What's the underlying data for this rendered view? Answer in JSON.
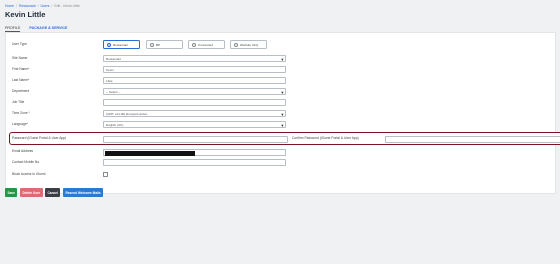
{
  "breadcrumb": {
    "home": "Home",
    "restaurant": "Restaurant",
    "users": "Users",
    "current": "Edit - Kevin Little"
  },
  "page": {
    "title": "Kevin Little"
  },
  "tabs": [
    {
      "label": "PROFILE"
    },
    {
      "label": "PACKAGE & SERVICE"
    }
  ],
  "form": {
    "user_type_label": "User Type",
    "user_types": [
      {
        "label": "Restaurant",
        "selected": true
      },
      {
        "label": "BP",
        "selected": false
      },
      {
        "label": "Connected",
        "selected": false
      },
      {
        "label": "Website Only",
        "selected": false
      }
    ],
    "site_name_label": "Site Name",
    "site_name_value": "Restaurant",
    "first_name_label": "First Name*",
    "first_name_value": "Kevin",
    "last_name_label": "Last Name*",
    "last_name_value": "Little",
    "department_label": "Department",
    "department_value": "-- Select --",
    "job_title_label": "Job Title",
    "job_title_value": "",
    "time_zone_label": "Time Zone *",
    "time_zone_value": "(GMT +01:00) Europe/London",
    "language_label": "Language*",
    "language_value": "English (UK)",
    "password_label": "Password (iGuest Portal & User App)",
    "confirm_password_label": "Confirm Password (iGuest Portal & User App)",
    "email_label": "Email Address",
    "contact_mobile_label": "Contact Mobile No.",
    "block_access_label": "Block Access to iGuest"
  },
  "buttons": {
    "save": "Save",
    "delete": "Delete User",
    "cancel": "Cancel",
    "resend": "Resend Welcome Mails"
  },
  "colors": {
    "accent": "#2a6bd6",
    "highlight_border": "#7a1622",
    "save": "#2a9445",
    "delete": "#e06a73",
    "cancel": "#3a3f47",
    "resend": "#2c79d2"
  }
}
